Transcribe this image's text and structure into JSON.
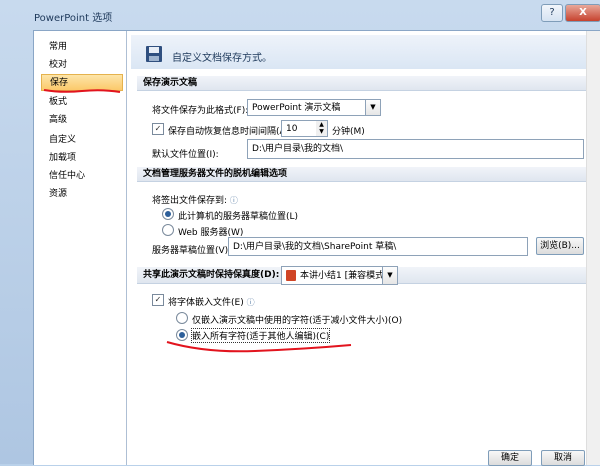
{
  "window": {
    "title": "PowerPoint 选项",
    "help_label": "?",
    "close_label": "X"
  },
  "nav": {
    "items": [
      {
        "label": "常用"
      },
      {
        "label": "校对"
      },
      {
        "label": "保存"
      },
      {
        "label": "板式"
      },
      {
        "label": "高级"
      },
      {
        "label": "自定义"
      },
      {
        "label": "加载项"
      },
      {
        "label": "信任中心"
      },
      {
        "label": "资源"
      }
    ]
  },
  "header": {
    "text": "自定义文档保存方式。"
  },
  "save_section": {
    "title": "保存演示文稿",
    "format_label": "将文件保存为此格式(F):",
    "format_value": "PowerPoint 演示文稿",
    "autorecover_label": "保存自动恢复信息时间间隔(A)",
    "autorecover_value": "10",
    "minutes_label": "分钟(M)",
    "default_location_label": "默认文件位置(I):",
    "default_location_value": "D:\\用户目录\\我的文档\\"
  },
  "server_section": {
    "title": "文档管理服务器文件的脱机编辑选项",
    "checkout_label": "将签出文件保存到:",
    "option_local": "此计算机的服务器草稿位置(L)",
    "option_web": "Web 服务器(W)",
    "drafts_label": "服务器草稿位置(V):",
    "drafts_value": "D:\\用户目录\\我的文档\\SharePoint 草稿\\",
    "browse_label": "浏览(B)..."
  },
  "fidelity_section": {
    "title": "共享此演示文稿时保持保真度(D):",
    "presentation_value": "本讲小结1 [兼容模式]",
    "embed_fonts_label": "将字体嵌入文件(E)",
    "option_used_chars": "仅嵌入演示文稿中使用的字符(适于减小文件大小)(O)",
    "option_all_chars": "嵌入所有字符(适于其他人编辑)(C)"
  },
  "footer": {
    "ok_label": "确定",
    "cancel_label": "取消"
  },
  "colors": {
    "selected_nav": "#fbc96b",
    "annotation": "#e2141e"
  }
}
